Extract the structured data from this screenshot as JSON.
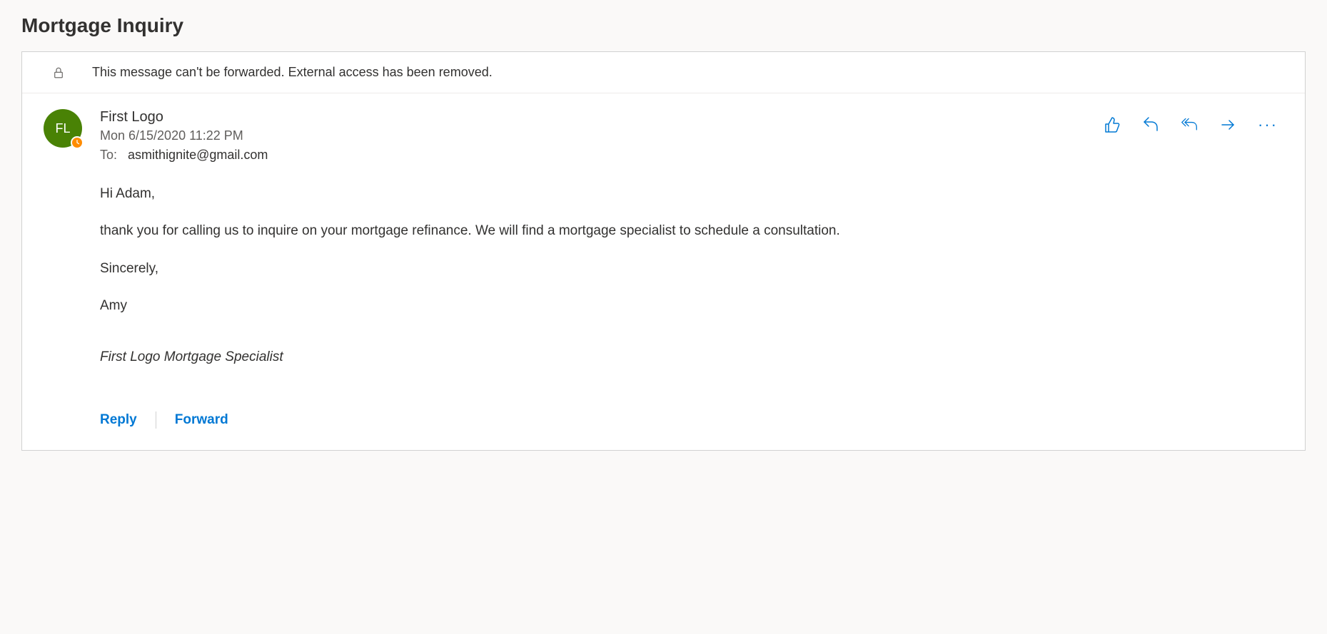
{
  "subject": "Mortgage Inquiry",
  "infoBar": {
    "text": "This message can't be forwarded. External access has been removed."
  },
  "sender": {
    "name": "First Logo",
    "initials": "FL"
  },
  "timestamp": "Mon 6/15/2020 11:22 PM",
  "recipients": {
    "toLabel": "To:",
    "toValue": "asmithignite@gmail.com"
  },
  "body": {
    "greeting": "Hi Adam,",
    "paragraph1": " thank you for calling us to inquire on your mortgage refinance.  We will find a mortgage specialist to schedule a consultation.",
    "closing": "Sincerely,",
    "signatureName": "Amy",
    "signatureTitle": "First Logo Mortgage Specialist"
  },
  "footer": {
    "reply": "Reply",
    "forward": "Forward"
  }
}
